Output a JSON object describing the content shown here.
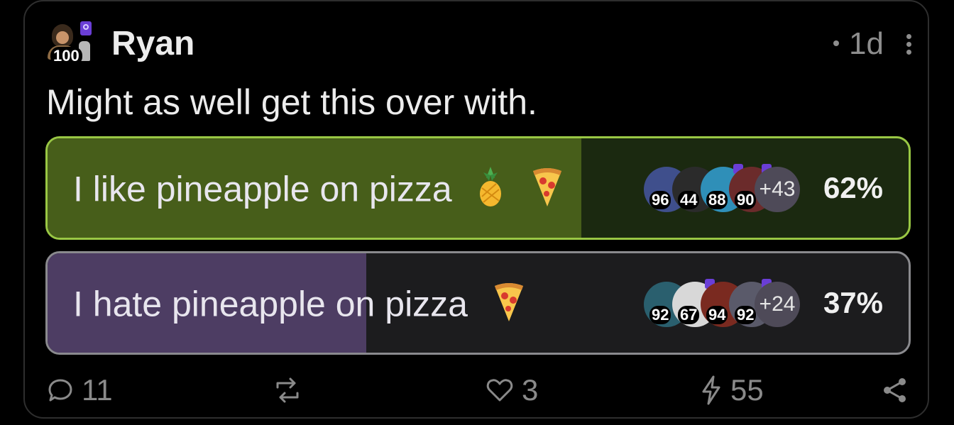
{
  "post": {
    "author": "Ryan",
    "author_level": "100",
    "time_ago": "1d",
    "text": "Might as well get this over with."
  },
  "poll": {
    "options": [
      {
        "label": "I like pineapple on pizza",
        "emojis": [
          "pineapple-emoji",
          "pizza-emoji"
        ],
        "percent": "62%",
        "fill_fraction": 0.62,
        "voter_levels": [
          "96",
          "44",
          "88",
          "90"
        ],
        "more_voters": "+43",
        "selected": true
      },
      {
        "label": "I hate pineapple on pizza",
        "emojis": [
          "pizza-emoji"
        ],
        "percent": "37%",
        "fill_fraction": 0.37,
        "voter_levels": [
          "92",
          "67",
          "94",
          "92"
        ],
        "more_voters": "+24",
        "selected": false
      }
    ]
  },
  "actions": {
    "comments": "11",
    "likes": "3",
    "boosts": "55"
  },
  "colors": {
    "selected_border": "#99c744",
    "selected_fill": "#475e1a",
    "other_fill": "#4d3d63",
    "muted": "#8a8a8a"
  }
}
